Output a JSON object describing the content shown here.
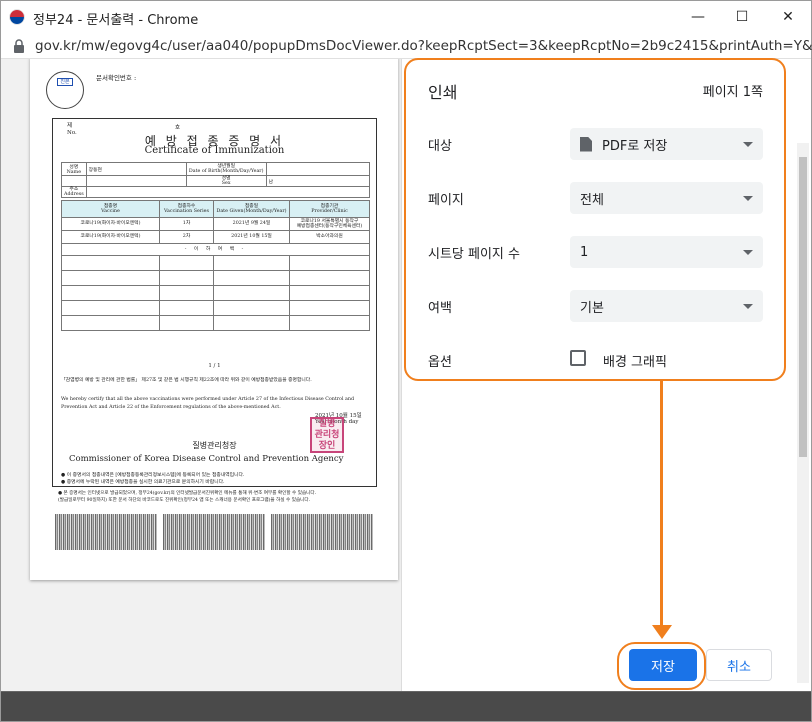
{
  "window": {
    "title": "정부24 - 문서출력 - Chrome",
    "minimize": "—",
    "maximize": "☐",
    "close": "✕"
  },
  "address": {
    "url": "gov.kr/mw/egovg4c/user/aa040/popupDmsDocViewer.do?keepRcptSect=3&keepRcptNo=2b9c2415&printAuth=Y&w"
  },
  "document": {
    "seal_top": "진본",
    "doc_check": "문서확인번호 :",
    "no_label": "제\nNo.",
    "ho_label": "호",
    "title_ko": "예 방 접 종 증 명 서",
    "title_en": "Certificate of Immunization",
    "info": {
      "name_label": "성명\nName",
      "name_value": "장동현",
      "dob_label": "생년월일\nDate of Birth(Month/Day/Year)",
      "sex_label": "성별\nSex",
      "sex_value": "남",
      "addr_label": "주소\nAddress"
    },
    "vac_headers": [
      "접종명\nVaccine",
      "접종차수\nVaccination Series",
      "접종일\nDate Given(Month/Day/Year)",
      "접종기관\nProvider/Clinic"
    ],
    "vac_rows": [
      [
        "코로나19(화이자·바이오엔텍)",
        "1차",
        "2021년  9월 24일",
        "코로나19 서울특별시 동작구\n예방접종센터(동작구민체육센터)"
      ],
      [
        "코로나19(화이자·바이오엔텍)",
        "2차",
        "2021년 10월 15일",
        "박소아과의원"
      ]
    ],
    "mark": "- 이  하  여  백 -",
    "page_num": "1 / 1",
    "legal_ko": "「감염병의 예방 및 관리에 관한 법률」 제27조 및 같은 법 시행규칙 제22조에 따라 위와 같이 예방접종받았음을 증명합니다.",
    "legal_en": "We hereby certify that all the above vaccinations were performed under Article 27 of the Infectious Disease Control and Prevention Act and Article 22 of the Enforcement regulations of the above-mentioned Act.",
    "date_ko": "2021년 10월 15일",
    "date_en": "Year  month  day",
    "agency_ko": "질병관리청장",
    "agency_en": "Commissioner of Korea Disease Control and Prevention Agency",
    "red_seal": "질병관리청장인",
    "note1": "● 이 증명서의 접종내역은 [예방접종등록관리정보시스템]에 등록되어 있는 접종내역입니다.\n● 증명서에 누락된 내역은 예방접종을 실시한 의료기관으로 문의하시기 바랍니다.",
    "note2": "● 본 증명서는 인터넷으로 발급되었으며, 정부24(gov.kr)의 인터넷발급문서진위확인 메뉴를 통해 위·변조 여부를 확인할 수 있습니다.\n(발급일로부터 90일까지) 또한 문서 하단의 바코드로도 진위확인(정부24 앱 또는 스캐너용 문서확인 프로그램)을 하실 수 있습니다."
  },
  "print": {
    "title": "인쇄",
    "pages_count": "페이지 1쪽",
    "destination_label": "대상",
    "destination_value": "PDF로 저장",
    "pages_label": "페이지",
    "pages_value": "전체",
    "per_sheet_label": "시트당 페이지 수",
    "per_sheet_value": "1",
    "margins_label": "여백",
    "margins_value": "기본",
    "options_label": "옵션",
    "background_graphics_label": "배경 그래픽",
    "background_graphics_checked": false,
    "save_label": "저장",
    "cancel_label": "취소"
  },
  "colors": {
    "accent": "#1a73e8",
    "highlight": "#f07f1d",
    "header_navy": "#1a2a66"
  }
}
